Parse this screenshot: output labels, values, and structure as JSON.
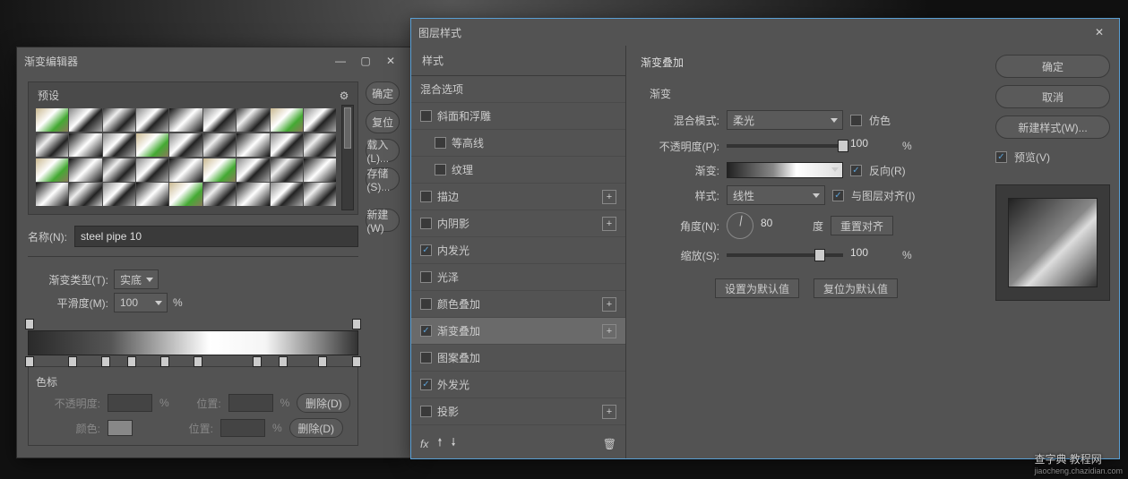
{
  "gradientEditor": {
    "title": "渐变编辑器",
    "presetsLabel": "预设",
    "gearIcon": "⚙",
    "buttons": {
      "ok": "确定",
      "reset": "复位",
      "load": "载入(L)...",
      "save": "存储(S)...",
      "new": "新建(W)"
    },
    "nameLabel": "名称(N):",
    "nameValue": "steel pipe 10",
    "gradTypeLabel": "渐变类型(T):",
    "gradTypeValue": "实底",
    "smoothLabel": "平滑度(M):",
    "smoothValue": "100",
    "smoothUnit": "%",
    "colorStopsTitle": "色标",
    "opacityLabel": "不透明度:",
    "positionLabel": "位置:",
    "deleteLabel": "删除(D)",
    "colorLabel": "颜色:",
    "percentUnit": "%"
  },
  "layerStyle": {
    "title": "图层样式",
    "stylesHeader": "样式",
    "blendHeader": "混合选项",
    "items": [
      {
        "label": "斜面和浮雕",
        "checked": false,
        "plus": false,
        "indent": false
      },
      {
        "label": "等高线",
        "checked": false,
        "plus": false,
        "indent": true
      },
      {
        "label": "纹理",
        "checked": false,
        "plus": false,
        "indent": true
      },
      {
        "label": "描边",
        "checked": false,
        "plus": true,
        "indent": false
      },
      {
        "label": "内阴影",
        "checked": false,
        "plus": true,
        "indent": false
      },
      {
        "label": "内发光",
        "checked": true,
        "plus": false,
        "indent": false
      },
      {
        "label": "光泽",
        "checked": false,
        "plus": false,
        "indent": false
      },
      {
        "label": "颜色叠加",
        "checked": false,
        "plus": true,
        "indent": false
      },
      {
        "label": "渐变叠加",
        "checked": true,
        "plus": true,
        "indent": false,
        "selected": true
      },
      {
        "label": "图案叠加",
        "checked": false,
        "plus": false,
        "indent": false
      },
      {
        "label": "外发光",
        "checked": true,
        "plus": false,
        "indent": false
      },
      {
        "label": "投影",
        "checked": false,
        "plus": true,
        "indent": false
      }
    ],
    "fxLabel": "fx",
    "settings": {
      "sectionTitle": "渐变叠加",
      "subTitle": "渐变",
      "blendModeLabel": "混合模式:",
      "blendModeValue": "柔光",
      "ditherLabel": "仿色",
      "opacityLabel": "不透明度(P):",
      "opacityValue": "100",
      "gradientLabel": "渐变:",
      "reverseLabel": "反向(R)",
      "styleLabel": "样式:",
      "styleValue": "线性",
      "alignLabel": "与图层对齐(I)",
      "angleLabel": "角度(N):",
      "angleValue": "80",
      "angleUnit": "度",
      "resetAlign": "重置对齐",
      "scaleLabel": "缩放(S):",
      "scaleValue": "100",
      "percentUnit": "%",
      "setDefault": "设置为默认值",
      "resetDefault": "复位为默认值"
    },
    "actions": {
      "ok": "确定",
      "cancel": "取消",
      "newStyle": "新建样式(W)...",
      "previewLabel": "预览(V)"
    }
  },
  "watermark": {
    "main": "查字典 教程网",
    "sub": "jiaocheng.chazidian.com"
  }
}
